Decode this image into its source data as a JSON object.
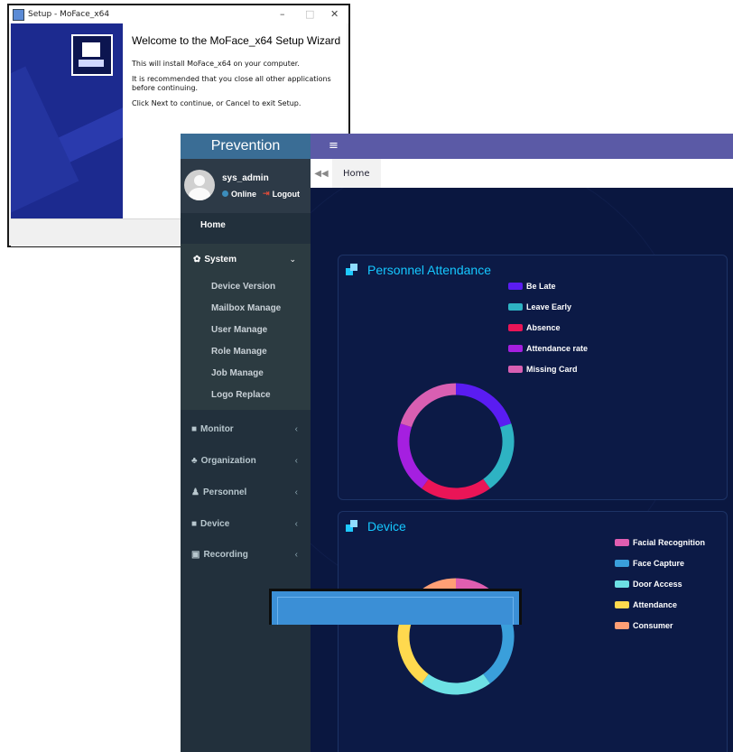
{
  "setup": {
    "window_title": "Setup - MoFace_x64",
    "min_btn": "–",
    "max_btn": "□",
    "close_btn": "✕",
    "heading": "Welcome to the MoFace_x64 Setup Wizard",
    "line1": "This will install MoFace_x64 on your computer.",
    "line2": "It is recommended that you close all other applications before continuing.",
    "line3": "Click Next to continue, or Cancel to exit Setup."
  },
  "sidebar": {
    "brand": "Prevention",
    "user": {
      "name": "sys_admin",
      "status": "Online",
      "logout": "Logout"
    },
    "home": "Home",
    "system": {
      "label": "System",
      "items": [
        "Device Version",
        "Mailbox Manage",
        "User Manage",
        "Role Manage",
        "Job Manage",
        "Logo Replace"
      ]
    },
    "menu": [
      "Monitor",
      "Organization",
      "Personnel",
      "Device",
      "Recording"
    ]
  },
  "topbar": {
    "menu_icon": "≡"
  },
  "tabs": {
    "back_icon": "◀◀",
    "home": "Home"
  },
  "panels": {
    "attendance": {
      "title": "Personnel Attendance",
      "legend": [
        {
          "label": "Be Late",
          "color": "#5a1cf2"
        },
        {
          "label": "Leave Early",
          "color": "#2eb3c3"
        },
        {
          "label": "Absence",
          "color": "#ea1557"
        },
        {
          "label": "Attendance rate",
          "color": "#a51fe0"
        },
        {
          "label": "Missing Card",
          "color": "#d85fb2"
        }
      ],
      "shares": [
        0.2,
        0.2,
        0.2,
        0.2,
        0.2
      ]
    },
    "device": {
      "title": "Device",
      "legend": [
        {
          "label": "Facial Recognition",
          "color": "#e05eb0"
        },
        {
          "label": "Face Capture",
          "color": "#3a9fdb"
        },
        {
          "label": "Door Access",
          "color": "#6de0e4"
        },
        {
          "label": "Attendance",
          "color": "#ffd94e"
        },
        {
          "label": "Consumer",
          "color": "#ff9f75"
        }
      ],
      "shares": [
        0.2,
        0.2,
        0.2,
        0.2,
        0.2
      ]
    }
  }
}
